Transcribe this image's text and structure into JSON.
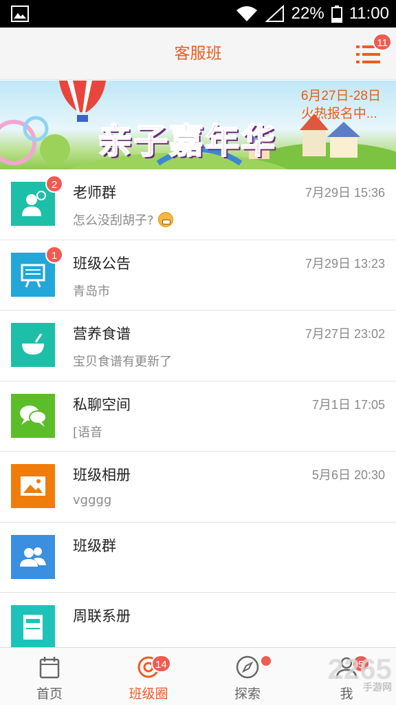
{
  "status_bar": {
    "battery": "22%",
    "time": "11:00"
  },
  "header": {
    "title": "客服班",
    "menu_badge": "11"
  },
  "banner": {
    "title": "亲子嘉年华",
    "line1": "6月27日-28日",
    "line2": "火热报名中..."
  },
  "list": [
    {
      "name": "老师群",
      "time": "7月29日 15:36",
      "sub": "怎么没刮胡子?",
      "badge": "2",
      "icon": "teacher-icon",
      "color": "#1dbfa8"
    },
    {
      "name": "班级公告",
      "time": "7月29日 13:23",
      "sub": "青岛市",
      "badge": "1",
      "icon": "board-icon",
      "color": "#22a7d8"
    },
    {
      "name": "营养食谱",
      "time": "7月27日 23:02",
      "sub": "宝贝食谱有更新了",
      "icon": "bowl-icon",
      "color": "#1dbfa8"
    },
    {
      "name": "私聊空间",
      "time": "7月1日 17:05",
      "sub": "[语音",
      "icon": "chat-icon",
      "color": "#5bbd2a"
    },
    {
      "name": "班级相册",
      "time": "5月6日 20:30",
      "sub": "vgggg",
      "icon": "photo-icon",
      "color": "#f07c0c"
    },
    {
      "name": "班级群",
      "time": "",
      "sub": "",
      "icon": "group-icon",
      "color": "#3a8fe0"
    },
    {
      "name": "周联系册",
      "time": "",
      "sub": "",
      "icon": "book-icon",
      "color": "#1ec2b8"
    }
  ],
  "bottom_nav": [
    {
      "label": "首页",
      "icon": "calendar-icon"
    },
    {
      "label": "班级圈",
      "icon": "circle-icon",
      "badge": "14",
      "active": true
    },
    {
      "label": "探索",
      "icon": "compass-icon",
      "dot": true
    },
    {
      "label": "我",
      "icon": "user-icon",
      "badge": "5"
    }
  ],
  "watermark": {
    "text": "2265",
    "sub": "手游网"
  },
  "colors": {
    "accent": "#f05a22",
    "badge": "#f05a50"
  }
}
